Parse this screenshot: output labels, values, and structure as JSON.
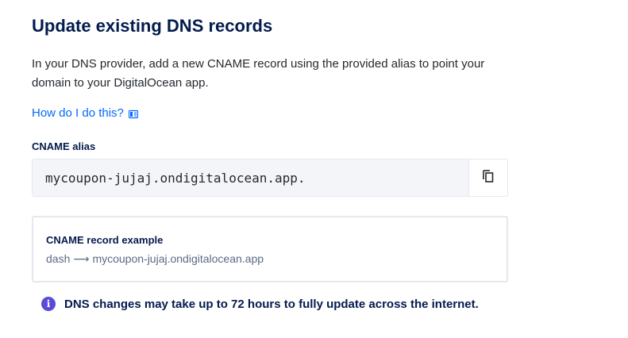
{
  "section": {
    "title": "Update existing DNS records",
    "description": "In your DNS provider, add a new CNAME record using the provided alias to point your domain to your DigitalOcean app.",
    "help_link": "How do I do this?",
    "help_link_icon": "book-icon"
  },
  "cname": {
    "label": "CNAME alias",
    "value": "mycoupon-jujaj.ondigitalocean.app.",
    "copy_icon": "copy-icon"
  },
  "example": {
    "title": "CNAME record example",
    "host": "dash",
    "arrow": "⟶",
    "target": "mycoupon-jujaj.ondigitalocean.app"
  },
  "notice": {
    "icon": "info-icon",
    "text": "DNS changes may take up to 72 hours to fully update across the internet."
  },
  "colors": {
    "accent_link": "#0069ff",
    "heading": "#031b4e",
    "info_icon": "#5b4bd9"
  }
}
